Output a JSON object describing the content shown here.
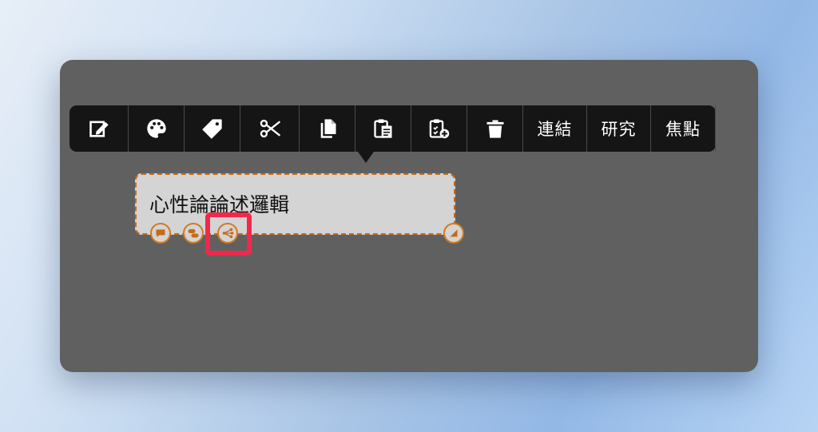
{
  "toolbar": {
    "buttons": [
      {
        "icon": "edit-icon",
        "interactable": true
      },
      {
        "icon": "palette-icon",
        "interactable": true
      },
      {
        "icon": "tag-icon",
        "interactable": true
      },
      {
        "icon": "scissors-icon",
        "interactable": true
      },
      {
        "icon": "copy-icon",
        "interactable": true
      },
      {
        "icon": "paste-icon",
        "interactable": true
      },
      {
        "icon": "paste-as-child-icon",
        "interactable": true
      },
      {
        "icon": "trash-icon",
        "interactable": true
      }
    ],
    "link_label": "連結",
    "research_label": "研究",
    "focus_label": "焦點"
  },
  "node": {
    "title": "心性論論述邏輯",
    "controls": [
      "comment-icon",
      "group-icon",
      "branch-icon",
      "resize-icon"
    ]
  },
  "colors": {
    "panel": "#606060",
    "toolbar": "#151515",
    "node_fill": "#d4d4d4",
    "node_border": "#c86a18",
    "highlight": "#f0294b"
  }
}
